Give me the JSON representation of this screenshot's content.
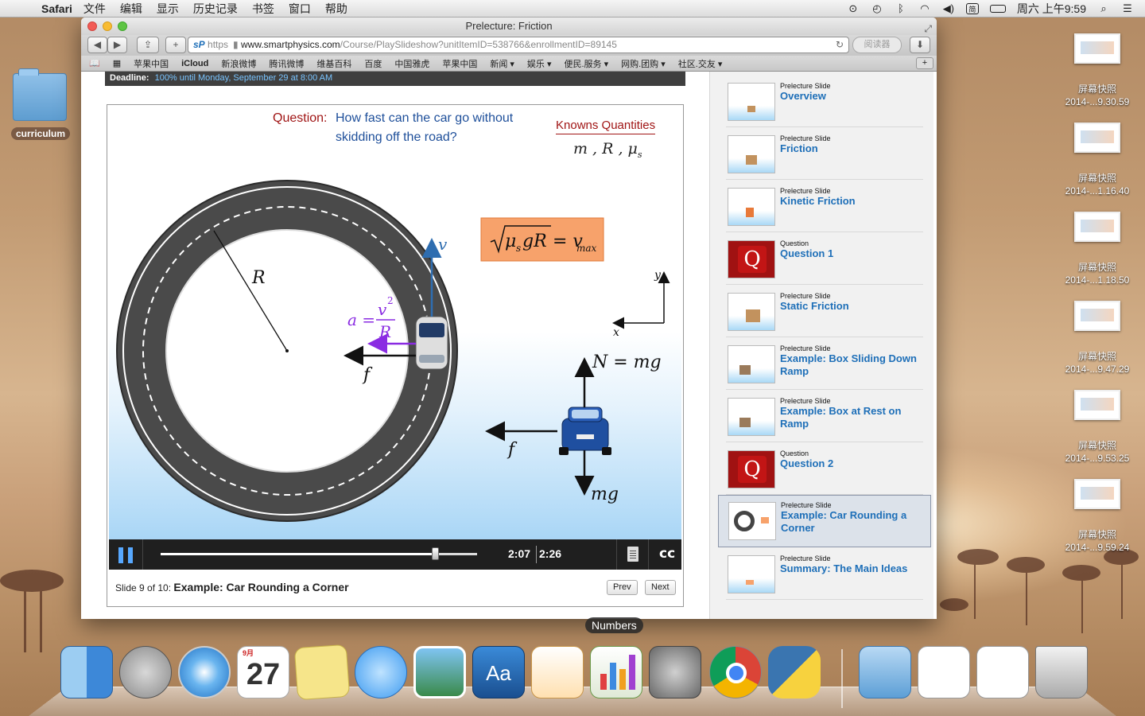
{
  "menubar": {
    "app": "Safari",
    "items": [
      "文件",
      "编辑",
      "显示",
      "历史记录",
      "书签",
      "窗口",
      "帮助"
    ],
    "clock": "周六 上午9:59"
  },
  "desktop": {
    "folder": "curriculum",
    "screenshots": [
      {
        "line1": "屏幕快照",
        "line2": "2014-...9.30.59"
      },
      {
        "line1": "屏幕快照",
        "line2": "2014-...1.16.40"
      },
      {
        "line1": "屏幕快照",
        "line2": "2014-...1.18.50"
      },
      {
        "line1": "屏幕快照",
        "line2": "2014-...9.47.29"
      },
      {
        "line1": "屏幕快照",
        "line2": "2014-...9.53.25"
      },
      {
        "line1": "屏幕快照",
        "line2": "2014-...9.59.24"
      }
    ]
  },
  "window": {
    "title": "Prelecture: Friction",
    "url_scheme": "https",
    "url_host": "www.smartphysics.com",
    "url_path": "/Course/PlaySlideshow?unitItemID=538766&enrollmentID=89145",
    "reader": "阅读器",
    "bookmarks": [
      "苹果中国",
      "iCloud",
      "新浪微博",
      "腾讯微博",
      "维基百科",
      "百度",
      "中国雅虎",
      "苹果中国",
      "新闻 ▾",
      "娱乐 ▾",
      "便民.服务 ▾",
      "网购.团购 ▾",
      "社区.交友 ▾"
    ]
  },
  "deadline": {
    "label": "Deadline:",
    "text": "100% until Monday, September 29 at 8:00 AM"
  },
  "slide": {
    "question_label": "Question:",
    "question_line1": "How fast can the car go without",
    "question_line2": "skidding off the road?",
    "knowns_title": "Knowns Quantities",
    "knowns_vars": "m , R , μ",
    "knowns_sub": "s",
    "formula_mu": "μ",
    "formula_s": "s",
    "formula_rest": "gR",
    "formula_eq": "= v",
    "formula_max": "max",
    "label_R": "R",
    "label_v": "v",
    "label_a": "a =",
    "label_v2": "v",
    "label_sq": "2",
    "label_Rden": "R",
    "label_f1": "f",
    "label_f2": "f",
    "label_N": "N = mg",
    "label_mg": "mg",
    "axis_y": "y",
    "axis_x": "x"
  },
  "player": {
    "current_time": "2:07",
    "total_time": "2:26",
    "progress_fraction": 0.87,
    "slide_prefix": "Slide 9 of 10:",
    "slide_title": "Example: Car Rounding a Corner",
    "prev": "Prev",
    "next": "Next"
  },
  "playlist": [
    {
      "type": "Prelecture Slide",
      "title": "Overview",
      "kind": "slide"
    },
    {
      "type": "Prelecture Slide",
      "title": "Friction",
      "kind": "slide"
    },
    {
      "type": "Prelecture Slide",
      "title": "Kinetic Friction",
      "kind": "slide"
    },
    {
      "type": "Question",
      "title": "Question 1",
      "kind": "question"
    },
    {
      "type": "Prelecture Slide",
      "title": "Static Friction",
      "kind": "slide"
    },
    {
      "type": "Prelecture Slide",
      "title": "Example: Box Sliding Down Ramp",
      "kind": "slide"
    },
    {
      "type": "Prelecture Slide",
      "title": "Example: Box at Rest on Ramp",
      "kind": "slide"
    },
    {
      "type": "Question",
      "title": "Question 2",
      "kind": "question"
    },
    {
      "type": "Prelecture Slide",
      "title": "Example: Car Rounding a Corner",
      "kind": "slide",
      "active": true
    },
    {
      "type": "Prelecture Slide",
      "title": "Summary: The Main Ideas",
      "kind": "slide"
    }
  ],
  "dock": {
    "tooltip": "Numbers",
    "calendar_month": "9月",
    "calendar_day": "27",
    "icons": [
      "finder-icon",
      "launchpad-icon",
      "safari-icon",
      "calendar-icon",
      "stickies-icon",
      "messages-icon",
      "iphoto-icon",
      "dictionary-icon",
      "pages-icon",
      "numbers-icon",
      "system-preferences-icon",
      "chrome-icon",
      "python-icon",
      "downloads-stack-icon",
      "documents-stack-icon",
      "screenshots-stack-icon",
      "trash-icon"
    ]
  }
}
